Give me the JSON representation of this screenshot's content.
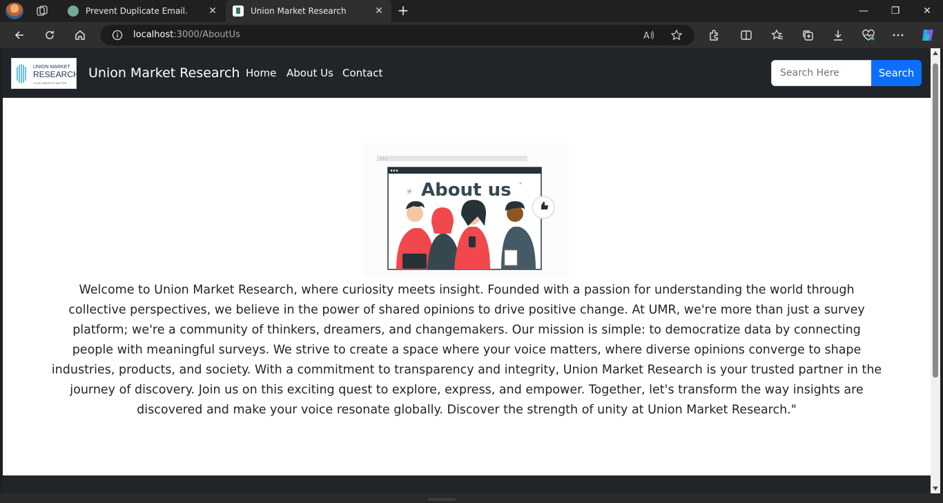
{
  "browser": {
    "tabs": [
      {
        "title": "Prevent Duplicate Email.",
        "active": false,
        "favicon": "chatgpt-icon"
      },
      {
        "title": "Union Market Research",
        "active": true,
        "favicon": "umr-favicon"
      }
    ],
    "new_tab_glyph": "+",
    "window_controls": {
      "minimize": "—",
      "maximize": "❐",
      "close": "✕"
    },
    "address": {
      "host": "localhost",
      "path": ":3000/AboutUs"
    },
    "colors": {
      "frame": "#202020",
      "toolbar": "#2f2f2f",
      "omnibox": "#1c1c1c"
    }
  },
  "navbar": {
    "logo_lines": [
      "UNION MARKET",
      "RESEARCH",
      "YOUR INSIGHTS MATTER"
    ],
    "brand": "Union Market Research",
    "links": [
      "Home",
      "About Us",
      "Contact"
    ],
    "search": {
      "placeholder": "Search Here",
      "button": "Search"
    },
    "colors": {
      "background": "#212529",
      "primary": "#0d6efd"
    }
  },
  "hero": {
    "title": "About us"
  },
  "about": {
    "text": "Welcome to Union Market Research, where curiosity meets insight. Founded with a passion for understanding the world through collective perspectives, we believe in the power of shared opinions to drive positive change. At UMR, we're more than just a survey platform; we're a community of thinkers, dreamers, and changemakers. Our mission is simple: to democratize data by connecting people with meaningful surveys. We strive to create a space where your voice matters, where diverse opinions converge to shape industries, products, and society. With a commitment to transparency and integrity, Union Market Research is your trusted partner in the journey of discovery. Join us on this exciting quest to explore, express, and empower. Together, let's transform the way insights are discovered and make your voice resonate globally. Discover the strength of unity at Union Market Research.\""
  }
}
